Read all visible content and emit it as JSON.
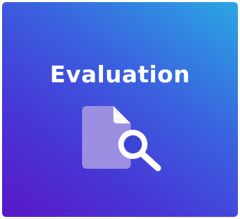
{
  "card": {
    "title": "Evaluation",
    "icon": "document-search-icon",
    "colors": {
      "gradient_top_right": "#2aa7e3",
      "gradient_mid": "#3a62df",
      "gradient_bottom_left": "#5a17c7",
      "title_text": "#ffffff",
      "document": "#9c8fe2",
      "magnifier_ring": "#ffffff",
      "magnifier_lens": "#3a46d3"
    }
  }
}
